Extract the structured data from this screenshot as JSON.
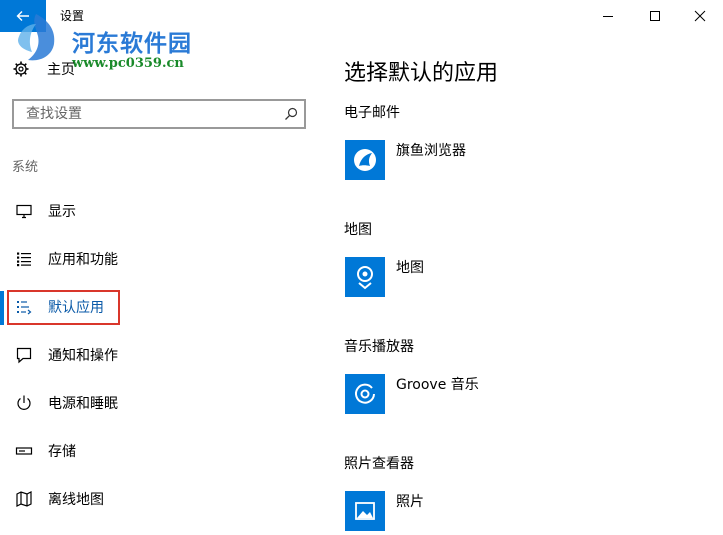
{
  "window": {
    "title": "设置"
  },
  "watermark": {
    "title": "河东软件园",
    "url": "www.pc0359.cn"
  },
  "nav": {
    "home_label": "主页",
    "search_placeholder": "查找设置",
    "section_label": "系统",
    "items": [
      {
        "label": "显示",
        "icon": "monitor-icon"
      },
      {
        "label": "应用和功能",
        "icon": "apps-list-icon"
      },
      {
        "label": "默认应用",
        "icon": "default-apps-icon",
        "active": true
      },
      {
        "label": "通知和操作",
        "icon": "notification-icon"
      },
      {
        "label": "电源和睡眠",
        "icon": "power-icon"
      },
      {
        "label": "存储",
        "icon": "storage-icon"
      },
      {
        "label": "离线地图",
        "icon": "offline-maps-icon"
      }
    ]
  },
  "main": {
    "title": "选择默认的应用",
    "categories": [
      {
        "label": "电子邮件",
        "app": "旗鱼浏览器",
        "icon": "browser-app-icon"
      },
      {
        "label": "地图",
        "app": "地图",
        "icon": "maps-app-icon"
      },
      {
        "label": "音乐播放器",
        "app": "Groove 音乐",
        "icon": "groove-music-icon"
      },
      {
        "label": "照片查看器",
        "app": "照片",
        "icon": "photos-app-icon"
      }
    ]
  },
  "colors": {
    "accent": "#0078d7",
    "highlight": "#d9362b",
    "active_text": "#0a5aa8"
  }
}
